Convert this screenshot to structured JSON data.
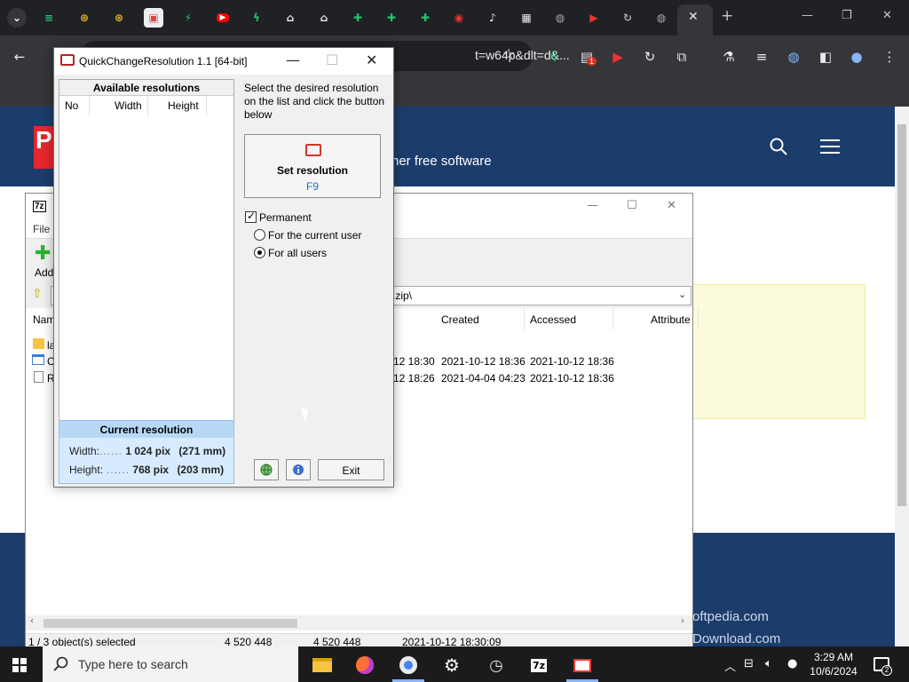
{
  "browser": {
    "tab_icons": [
      "menu-down-icon",
      "pinned-tab-1",
      "pinned-tab-2",
      "pinned-tab-3",
      "pinned-tab-4",
      "youtube-icon",
      "bolt-icon",
      "bank-icon",
      "bank-icon",
      "puzzle-icon",
      "puzzle-icon",
      "puzzle-icon",
      "record-icon",
      "speaker-icon",
      "app-icon",
      "globe-icon",
      "video-icon",
      "sync-icon",
      "globe-icon"
    ],
    "active_tab_close": "✕",
    "new_tab": "+",
    "address_fragment": "t=w64p&dlt=d&...",
    "extension_badge": "1"
  },
  "website": {
    "tagline": "her free software",
    "footer_title": "xternal links",
    "footer_links": [
      "oftpedia.com",
      "Download.com"
    ]
  },
  "sevenzip": {
    "menu_file": "File",
    "toolbar_add": "Add",
    "path": ".zip\\",
    "columns": [
      "Nam",
      "Created",
      "Accessed",
      "Attribute"
    ],
    "rows": [
      {
        "name": "la",
        "modified_tail": "12 18:30",
        "created": "2021-10-12 18:36",
        "accessed": "2021-10-12 18:36"
      },
      {
        "name": "C",
        "modified_tail": "12 18:26",
        "created": "2021-04-04 04:23",
        "accessed": "2021-10-12 18:36"
      },
      {
        "name": "R",
        "modified_tail": "",
        "created": "",
        "accessed": ""
      }
    ],
    "status": {
      "selected": "1 / 3 object(s) selected",
      "size": "4 520 448",
      "packed": "4 520 448",
      "modified": "2021-10-12 18:30:09"
    }
  },
  "qcr": {
    "title": "QuickChangeResolution 1.1  [64-bit]",
    "list_header": "Available resolutions",
    "columns": [
      "No",
      "Width",
      "Height"
    ],
    "instructions": "Select the desired resolution on the list and click the button below",
    "set_button": "Set resolution",
    "set_hotkey": "F9",
    "permanent_label": "Permanent",
    "permanent_checked": true,
    "scope_options": [
      "For the current user",
      "For all users"
    ],
    "scope_selected": "For all users",
    "current_header": "Current resolution",
    "width_label": "Width:",
    "width_dots": "......",
    "width_value": "1 024 pix",
    "width_mm": "(271 mm)",
    "height_label": "Height:",
    "height_dots": "......",
    "height_value": "768 pix",
    "height_mm": "(203 mm)",
    "exit_button": "Exit"
  },
  "taskbar": {
    "search_placeholder": "Type here to search",
    "time": "3:29 AM",
    "date": "10/6/2024",
    "notification_count": "2"
  }
}
